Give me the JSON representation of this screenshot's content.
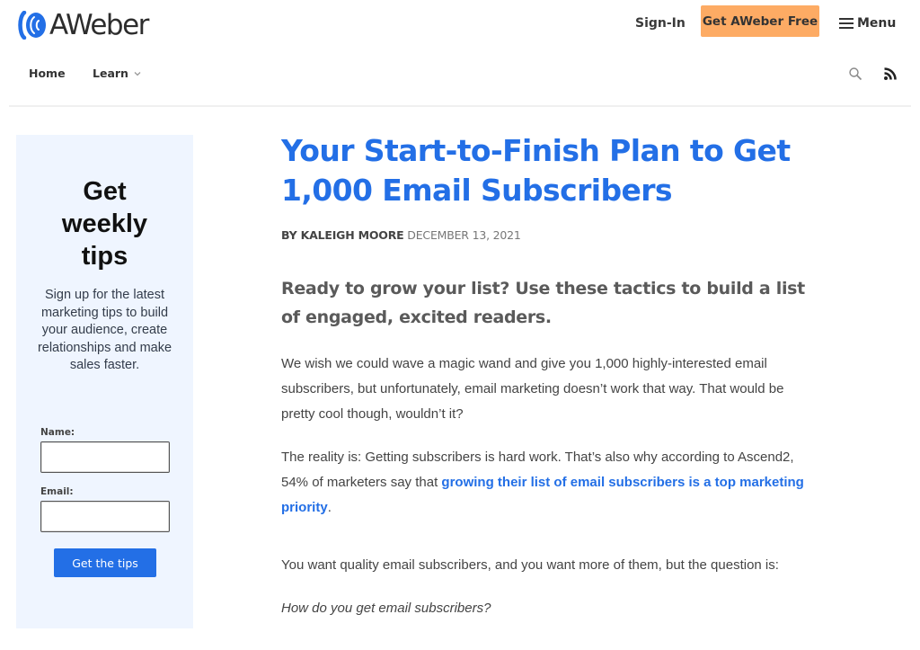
{
  "header": {
    "logo_text": "AWeber",
    "signin_label": "Sign-In",
    "cta_label": "Get AWeber Free",
    "menu_label": "Menu"
  },
  "nav": {
    "home_label": "Home",
    "learn_label": "Learn"
  },
  "icons": {
    "search": "search-icon",
    "rss": "rss-icon",
    "menu": "hamburger-icon",
    "dropdown": "chevron-down-icon"
  },
  "colors": {
    "brand_blue": "#236fe6",
    "cta_orange": "#fdab64",
    "sidebar_bg": "#eff5ff"
  },
  "sidebar": {
    "title": "Get weekly tips",
    "description": "Sign up for the latest marketing tips to build your audience, create relationships and make sales faster.",
    "name_label": "Name:",
    "name_value": "",
    "email_label": "Email:",
    "email_value": "",
    "submit_label": "Get the tips"
  },
  "article": {
    "title": "Your Start-to-Finish Plan to Get 1,000 Email Subscribers",
    "byline_prefix": "BY",
    "author": "KALEIGH MOORE",
    "date": "DECEMBER 13, 2021",
    "lead": "Ready to grow your list? Use these tactics to build a list of engaged, excited readers.",
    "p1": "We wish we could wave a magic wand and give you 1,000 highly-interested email subscribers, but unfortunately, email marketing doesn’t work that way. That would be pretty cool though, wouldn’t it?",
    "p2_before": "The reality is: Getting subscribers is hard work. That’s also why according to Ascend2, 54% of marketers say that ",
    "p2_link": "growing their list of email subscribers is a top marketing priority",
    "p2_after": ".",
    "p3": "You want quality email subscribers, and you want more of them, but the question is:",
    "p4": "How do you get email subscribers?"
  }
}
